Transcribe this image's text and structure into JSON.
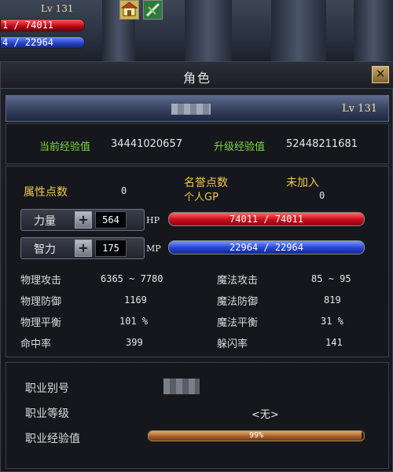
{
  "hud": {
    "level": "Lv 131",
    "hp_text": "1 / 74011",
    "mp_text": "4 / 22964"
  },
  "window": {
    "title": "角色",
    "close_icon": "close-icon"
  },
  "character": {
    "level": "Lv 131"
  },
  "experience": {
    "current_label": "当前经验值",
    "current_value": "34441020657",
    "next_label": "升级经验值",
    "next_value": "52448211681"
  },
  "attributes": {
    "points_label": "属性点数",
    "points_value": "0",
    "honor_label": "名誉点数",
    "honor_status": "未加入",
    "gp_label": "个人GP",
    "gp_value": "0",
    "strength_label": "力量",
    "strength_value": "564",
    "intelligence_label": "智力",
    "intelligence_value": "175",
    "hp_label": "HP",
    "hp_text": "74011 / 74011",
    "hp_fraction": 1.0,
    "mp_label": "MP",
    "mp_text": "22964 / 22964",
    "mp_fraction": 1.0
  },
  "stats": {
    "phys_atk_label": "物理攻击",
    "phys_atk_value": "6365 ~ 7780",
    "mag_atk_label": "魔法攻击",
    "mag_atk_value": "85 ~ 95",
    "phys_def_label": "物理防御",
    "phys_def_value": "1169",
    "mag_def_label": "魔法防御",
    "mag_def_value": "819",
    "phys_bal_label": "物理平衡",
    "phys_bal_value": "101 %",
    "mag_bal_label": "魔法平衡",
    "mag_bal_value": "31 %",
    "hit_label": "命中率",
    "hit_value": "399",
    "dodge_label": "躲闪率",
    "dodge_value": "141"
  },
  "job": {
    "alias_label": "职业别号",
    "level_label": "职业等级",
    "level_value": "<无>",
    "exp_label": "职业经验值",
    "exp_text": "99%",
    "exp_fraction": 0.99
  },
  "colors": {
    "accent_gold": "#f0c94a",
    "label_green": "#7dd63f",
    "hp_red": "#d01020",
    "mp_blue": "#2b49d6"
  }
}
